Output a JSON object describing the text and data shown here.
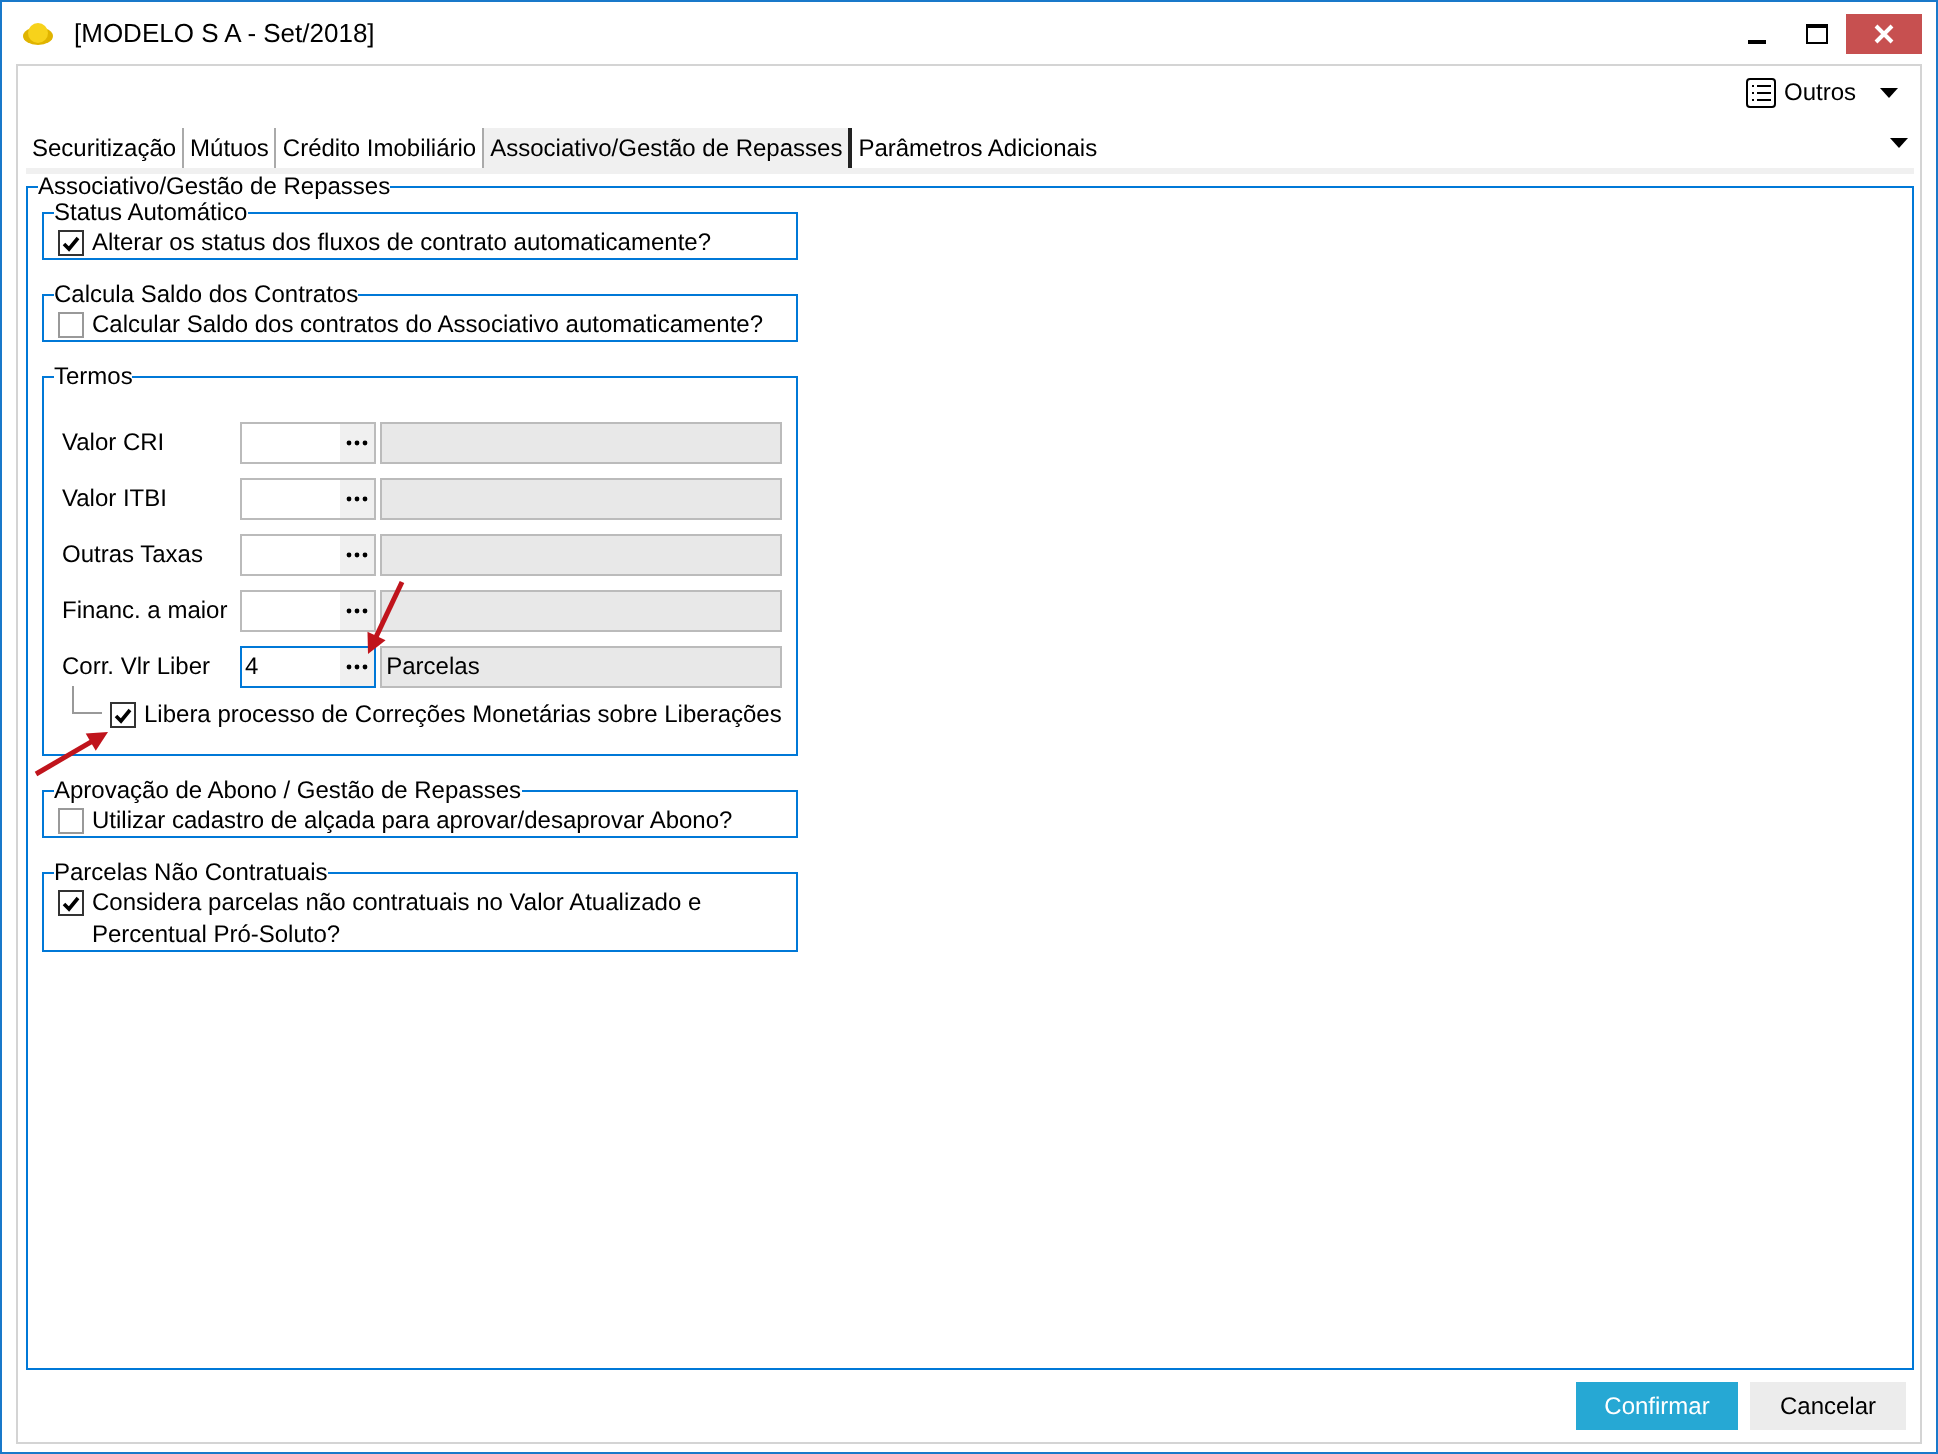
{
  "window": {
    "title": "[MODELO S A - Set/2018]"
  },
  "toolbar": {
    "menu_label": "Outros"
  },
  "tabs": [
    {
      "label": "Securitização",
      "selected": false
    },
    {
      "label": "Mútuos",
      "selected": false
    },
    {
      "label": "Crédito Imobiliário",
      "selected": false
    },
    {
      "label": "Associativo/Gestão de Repasses",
      "selected": true
    },
    {
      "label": "Parâmetros Adicionais",
      "selected": false
    }
  ],
  "panel": {
    "title": "Associativo/Gestão de Repasses",
    "groups": [
      {
        "kind": "check",
        "title": "Status Automático",
        "options": [
          {
            "label": "Alterar os status dos fluxos de contrato automaticamente?",
            "checked": true
          }
        ]
      },
      {
        "kind": "check",
        "title": "Calcula Saldo dos Contratos",
        "options": [
          {
            "label": "Calcular Saldo dos contratos do Associativo automaticamente?",
            "checked": false
          }
        ]
      },
      {
        "kind": "terms",
        "title": "Termos",
        "fields": [
          {
            "label": "Valor CRI",
            "focused": false
          },
          {
            "label": "Valor ITBI",
            "focused": false
          },
          {
            "label": "Outras Taxas",
            "focused": false
          },
          {
            "label": "Financ. a maior",
            "focused": false
          },
          {
            "label": "Corr. Vlr Liber",
            "value": "4",
            "description": "Parcelas",
            "focused": true
          }
        ],
        "sub_option": {
          "label": "Libera processo de Correções Monetárias sobre Liberações",
          "checked": true
        }
      },
      {
        "kind": "check",
        "title": "Aprovação de Abono / Gestão de Repasses",
        "options": [
          {
            "label": "Utilizar cadastro de alçada para aprovar/desaprovar Abono?",
            "checked": false
          }
        ]
      },
      {
        "kind": "check",
        "title": "Parcelas Não Contratuais",
        "options": [
          {
            "label": "Considera parcelas não contratuais no Valor Atualizado e Percentual Pró-Soluto?",
            "checked": true
          }
        ]
      }
    ]
  },
  "buttons": [
    {
      "label": "Confirmar",
      "kind": "primary"
    },
    {
      "label": "Cancelar",
      "kind": "secondary"
    }
  ]
}
